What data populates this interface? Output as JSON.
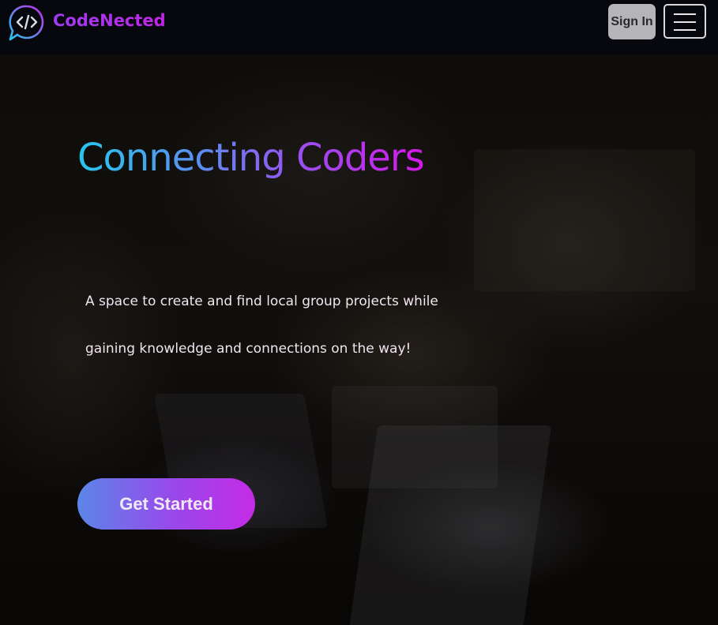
{
  "navbar": {
    "brand": "CodeNected",
    "logo_icon": "code-brackets-chat-icon",
    "signin_label": "Sign In",
    "menu_icon": "hamburger-menu-icon"
  },
  "hero": {
    "title": "Connecting Coders",
    "description_line1": "A space to create and find local group projects while",
    "description_line2": "gaining knowledge and connections on the way!",
    "cta_label": "Get Started"
  },
  "colors": {
    "navbar_bg": "#07080d",
    "brand_gradient": [
      "#9d3cf2",
      "#c026e6"
    ],
    "title_gradient": [
      "#27c6ec",
      "#5b8ef0",
      "#9b4ef0",
      "#d418e8"
    ],
    "cta_gradient": [
      "#5b86e8",
      "#9a47ea",
      "#c42ce6"
    ],
    "signin_bg": "#b5b5b8"
  }
}
